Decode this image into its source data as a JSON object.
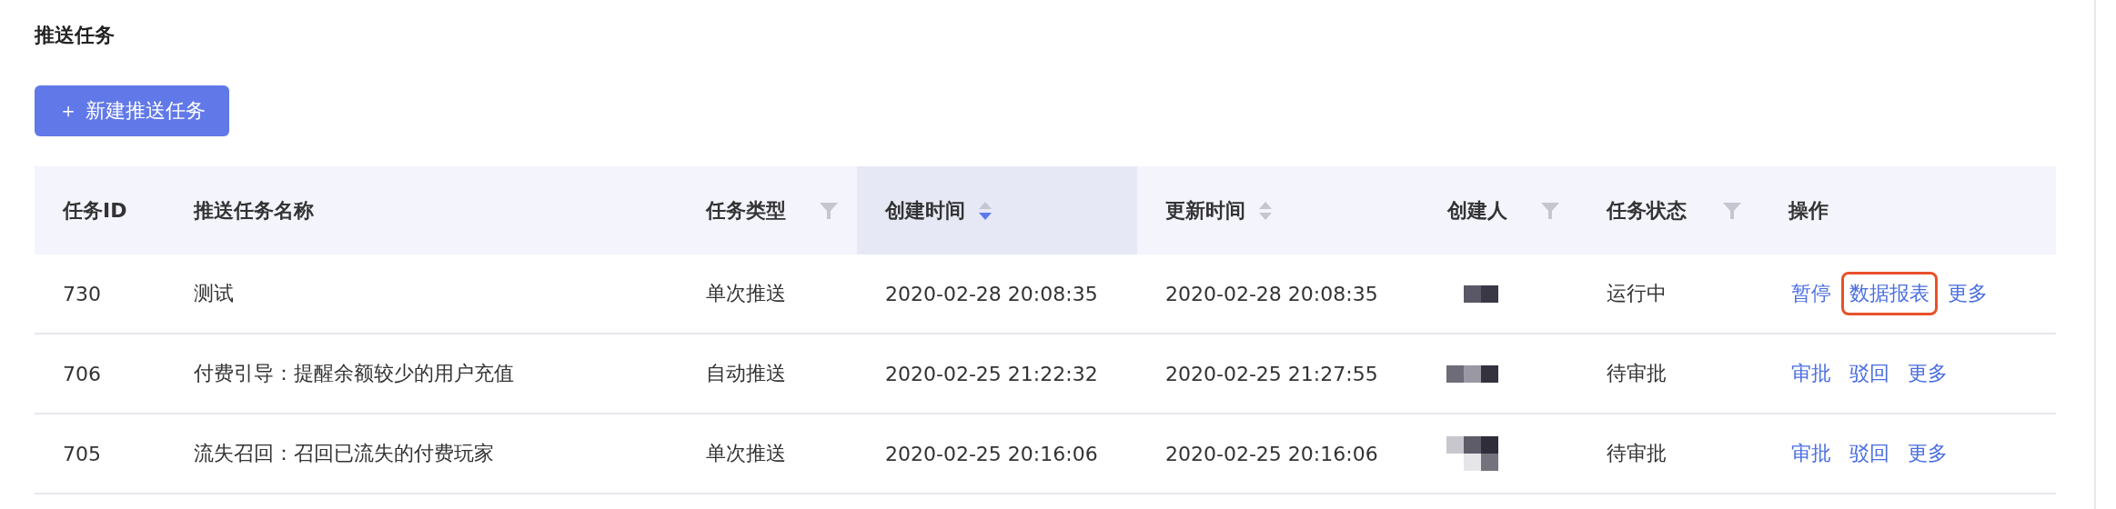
{
  "title": "推送任务",
  "create_button": {
    "icon": "＋",
    "label": "新建推送任务"
  },
  "table": {
    "columns": [
      {
        "label": "任务ID",
        "filter": false,
        "sortable": false,
        "sorted": false
      },
      {
        "label": "推送任务名称",
        "filter": false,
        "sortable": false,
        "sorted": false
      },
      {
        "label": "任务类型",
        "filter": true,
        "sortable": false,
        "sorted": false
      },
      {
        "label": "创建时间",
        "filter": false,
        "sortable": true,
        "sorted": true
      },
      {
        "label": "更新时间",
        "filter": false,
        "sortable": true,
        "sorted": false
      },
      {
        "label": "创建人",
        "filter": true,
        "sortable": false,
        "sorted": false
      },
      {
        "label": "任务状态",
        "filter": true,
        "sortable": false,
        "sorted": false
      },
      {
        "label": "操作",
        "filter": false,
        "sortable": false,
        "sorted": false
      }
    ],
    "rows": [
      {
        "id": "730",
        "name": "测试",
        "type": "单次推送",
        "created": "2020-02-28 20:08:35",
        "updated": "2020-02-28 20:08:35",
        "status": "运行中",
        "actions": [
          {
            "label": "暂停",
            "highlighted": false
          },
          {
            "label": "数据报表",
            "highlighted": true
          },
          {
            "label": "更多",
            "highlighted": false
          }
        ]
      },
      {
        "id": "706",
        "name": "付费引导：提醒余额较少的用户充值",
        "type": "自动推送",
        "created": "2020-02-25 21:22:32",
        "updated": "2020-02-25 21:27:55",
        "status": "待审批",
        "actions": [
          {
            "label": "审批",
            "highlighted": false
          },
          {
            "label": "驳回",
            "highlighted": false
          },
          {
            "label": "更多",
            "highlighted": false
          }
        ]
      },
      {
        "id": "705",
        "name": "流失召回：召回已流失的付费玩家",
        "type": "单次推送",
        "created": "2020-02-25 20:16:06",
        "updated": "2020-02-25 20:16:06",
        "status": "待审批",
        "actions": [
          {
            "label": "审批",
            "highlighted": false
          },
          {
            "label": "驳回",
            "highlighted": false
          },
          {
            "label": "更多",
            "highlighted": false
          }
        ]
      }
    ]
  }
}
